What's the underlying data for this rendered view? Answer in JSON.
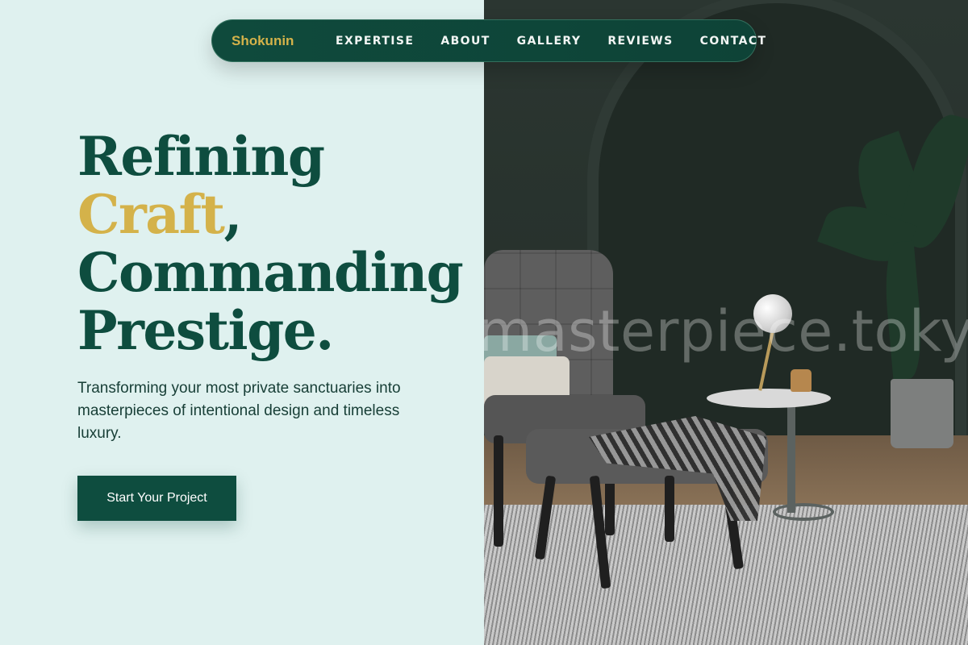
{
  "nav": {
    "brand": "Shokunin",
    "links": [
      "EXPERTISE",
      "ABOUT",
      "GALLERY",
      "REVIEWS",
      "CONTACT"
    ]
  },
  "hero": {
    "line1": "Refining",
    "line2_accent": "Craft",
    "line2_rest": ",",
    "line3": "Commanding",
    "line4": "Prestige."
  },
  "subtitle": "Transforming your most private sanctuaries into masterpieces of intentional design and timeless luxury.",
  "cta": {
    "label": "Start Your Project"
  },
  "image": {
    "watermark": "masterpiece.tokyo"
  },
  "colors": {
    "primary": "#0e4d3f",
    "accent": "#d4b24a",
    "background": "#dff1ef"
  }
}
